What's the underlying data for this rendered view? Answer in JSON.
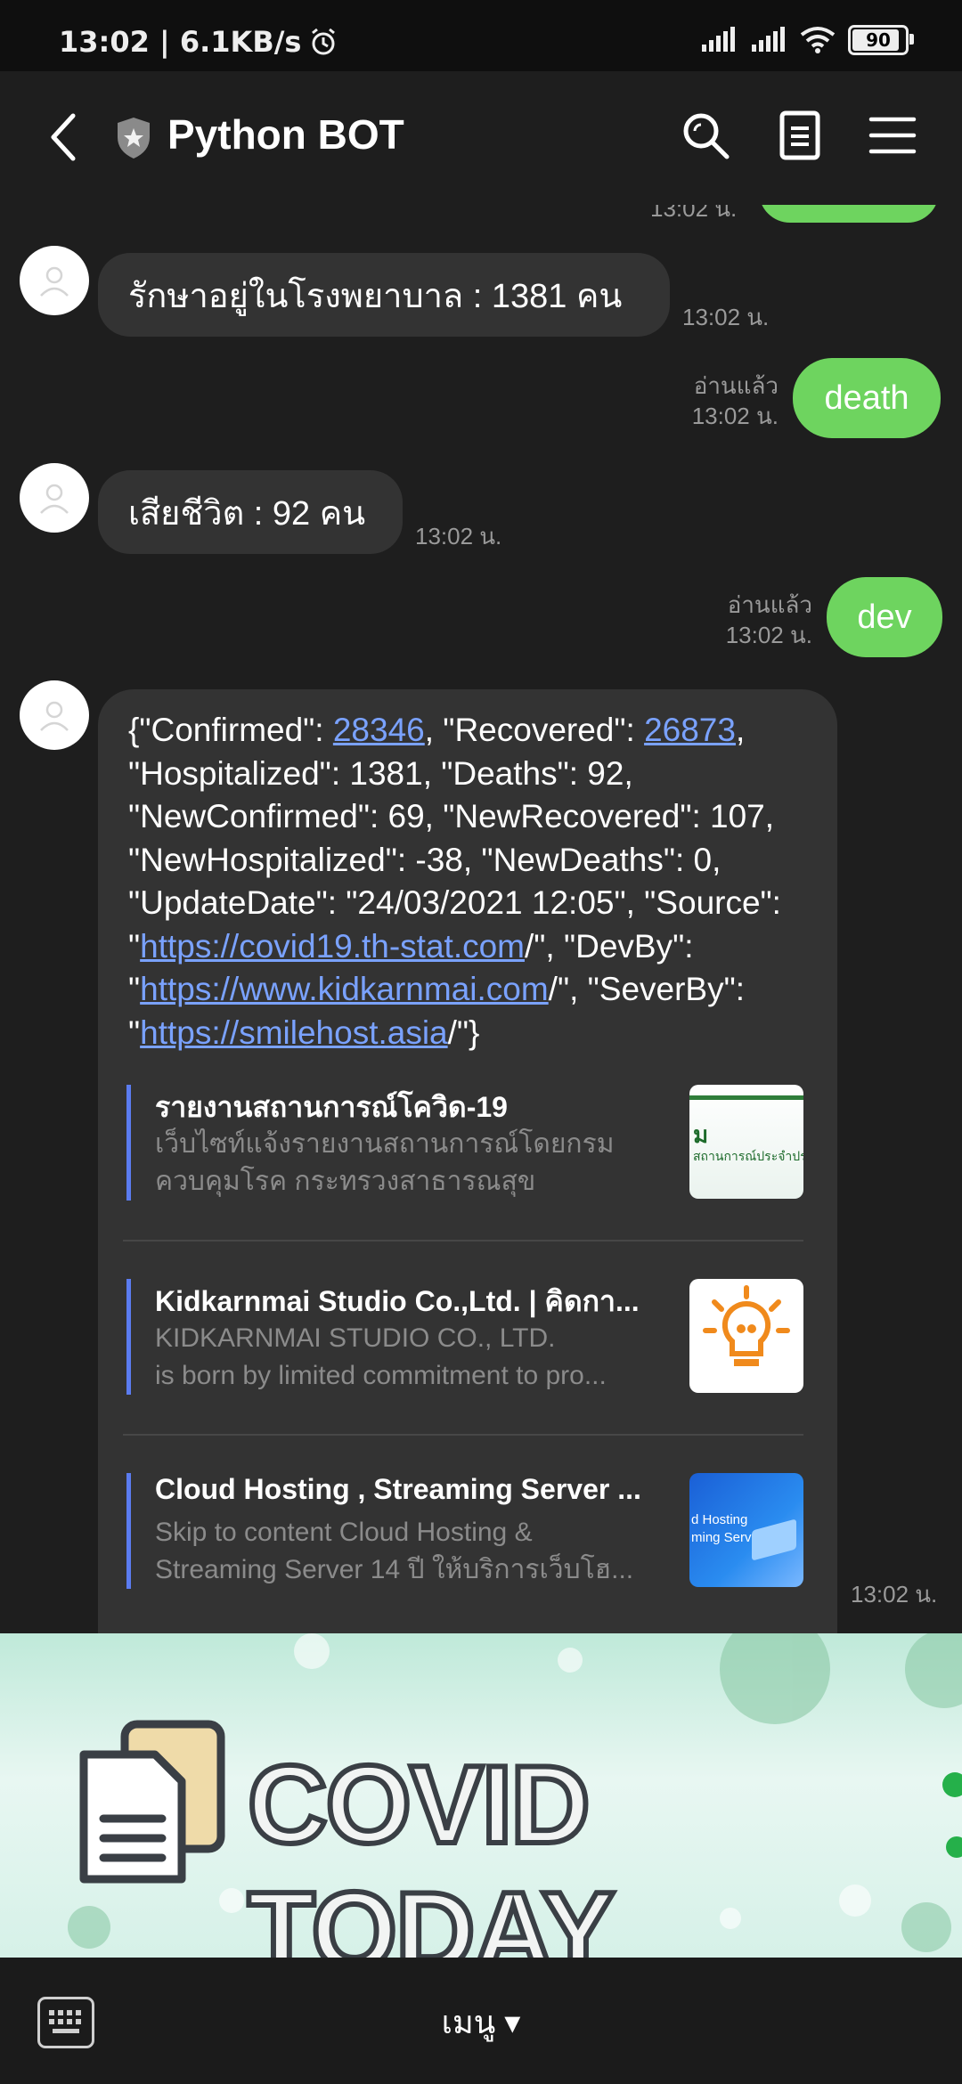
{
  "status_bar": {
    "time_speed": "13:02 | 6.1KB/s",
    "battery": "90",
    "battery_level": 0.9
  },
  "header": {
    "title": "Python BOT",
    "icons": [
      "back-icon",
      "shield-star-icon",
      "search-icon",
      "notes-icon",
      "menu-icon"
    ]
  },
  "messages": [
    {
      "type": "in",
      "text": "รักษาอยู่ในโรงพยาบาล : 1381 คน",
      "time": "13:02 น."
    },
    {
      "type": "out",
      "text": "death",
      "read": "อ่านแล้ว",
      "time": "13:02 น."
    },
    {
      "type": "in",
      "text": "เสียชีวิต : 92 คน",
      "time": "13:02 น."
    },
    {
      "type": "out",
      "text": "dev",
      "read": "อ่านแล้ว",
      "time": "13:02 น."
    },
    {
      "type": "in-json",
      "json": {
        "p1": "{\"Confirmed\": ",
        "n1": "28346",
        "p2": ", \"Recovered\": ",
        "n2": "26873",
        "p3": ", \"Hospitalized\": 1381, \"Deaths\": 92, \"NewConfirmed\": 69, \"NewRecovered\": 107, \"NewHospitalized\": -38, \"NewDeaths\": 0, \"UpdateDate\": \"24/03/2021 12:05\", \"Source\": \"",
        "l1": "https://covid19.th-stat.com",
        "p4": "/\", \"DevBy\": \"",
        "l2": "https://www.kidkarnmai.com",
        "p5": "/\", \"SeverBy\": \"",
        "l3": "https://smilehost.asia",
        "p6": "/\"}"
      },
      "previews": [
        {
          "title": "รายงานสถานการณ์โควิด-19",
          "desc1": "เว็บไซท์แจ้งรายงานสถานการณ์โดยกรม",
          "desc2": "ควบคุมโรค กระทรวงสาธารณสุข",
          "thumb_line1": "ม",
          "thumb_line2": "สถานการณ์ประจำประเทศ"
        },
        {
          "title": "Kidkarnmai Studio Co.,Ltd. | คิดกา...",
          "desc1": "KIDKARNMAI STUDIO CO., LTD.",
          "desc2": "is born by limited commitment to pro..."
        },
        {
          "title": "Cloud Hosting , Streaming Server ...",
          "desc1": "Skip to content Cloud Hosting &",
          "desc2": "Streaming Server 14 ปี ให้บริการเว็บโฮ...",
          "thumb_line1": "d Hosting",
          "thumb_line2": "ming Server"
        }
      ],
      "time": "13:02 น."
    }
  ],
  "partial_top_time": "13:02 น.",
  "banner": {
    "text": "COVID TODAY"
  },
  "bottom_bar": {
    "menu_label": "เมนู ▾"
  },
  "colors": {
    "outgoing": "#6ed45f",
    "incoming": "#333333",
    "link": "#7aa2ff",
    "preview_bar": "#5b7cf0"
  }
}
